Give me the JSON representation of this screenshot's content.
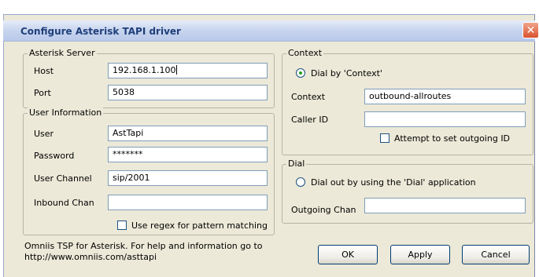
{
  "window": {
    "title": "Configure Asterisk TAPI driver"
  },
  "asterisk_server": {
    "legend": "Asterisk Server",
    "host_label": "Host",
    "host_value": "192.168.1.100",
    "port_label": "Port",
    "port_value": "5038"
  },
  "user_information": {
    "legend": "User Information",
    "user_label": "User",
    "user_value": "AstTapi",
    "password_label": "Password",
    "password_value": "*******",
    "user_channel_label": "User Channel",
    "user_channel_value": "sip/2001",
    "inbound_chan_label": "Inbound Chan",
    "inbound_chan_value": "",
    "regex_label": "Use regex for pattern matching",
    "regex_checked": false
  },
  "context": {
    "legend": "Context",
    "dial_by_context_label": "Dial by 'Context'",
    "dial_by_context_selected": true,
    "context_label": "Context",
    "context_value": "outbound-allroutes",
    "caller_id_label": "Caller ID",
    "caller_id_value": "",
    "outgoing_id_label": "Attempt to set outgoing ID",
    "outgoing_id_checked": false
  },
  "dial": {
    "legend": "Dial",
    "dial_app_label": "Dial out by using the 'Dial' application",
    "dial_app_selected": false,
    "outgoing_chan_label": "Outgoing Chan",
    "outgoing_chan_value": ""
  },
  "footer": {
    "line1": "Omniis TSP for Asterisk. For help and information go to",
    "line2": "http://www.omniis.com/asttapi"
  },
  "buttons": {
    "ok": "OK",
    "apply": "Apply",
    "cancel": "Cancel"
  },
  "colors": {
    "dialog_bg": "#ece9d8",
    "title_text": "#1f3f7a",
    "close_button": "#d9532e"
  },
  "icons": {
    "close": "close-icon",
    "radio": "radio-icon",
    "checkbox": "checkbox-icon"
  }
}
